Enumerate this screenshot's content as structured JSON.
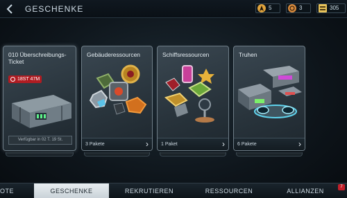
{
  "header": {
    "title": "GESCHENKE",
    "resources": [
      {
        "icon": "starfleet-delta-icon",
        "value": "5"
      },
      {
        "icon": "latinum-coin-icon",
        "value": "3"
      },
      {
        "icon": "gold-bar-icon",
        "value": "305"
      }
    ]
  },
  "cards": [
    {
      "title": "010 Überschreibungs-Ticket",
      "timer": "18ST 47M",
      "availability": "Verfügbar in 02 T. 19 St."
    },
    {
      "title": "Gebäuderessourcen",
      "footer": "3 Pakete"
    },
    {
      "title": "Schiffsressourcen",
      "footer": "1 Paket"
    },
    {
      "title": "Truhen",
      "footer": "6 Pakete"
    }
  ],
  "nav": {
    "tabs": [
      "OTE",
      "GESCHENKE",
      "REKRUTIEREN",
      "RESSOURCEN",
      "ALLIANZEN"
    ],
    "active": "GESCHENKE",
    "alliance_badge": "7"
  },
  "colors": {
    "accent_red": "#b01c22",
    "active_tab": "#e9eef1"
  }
}
